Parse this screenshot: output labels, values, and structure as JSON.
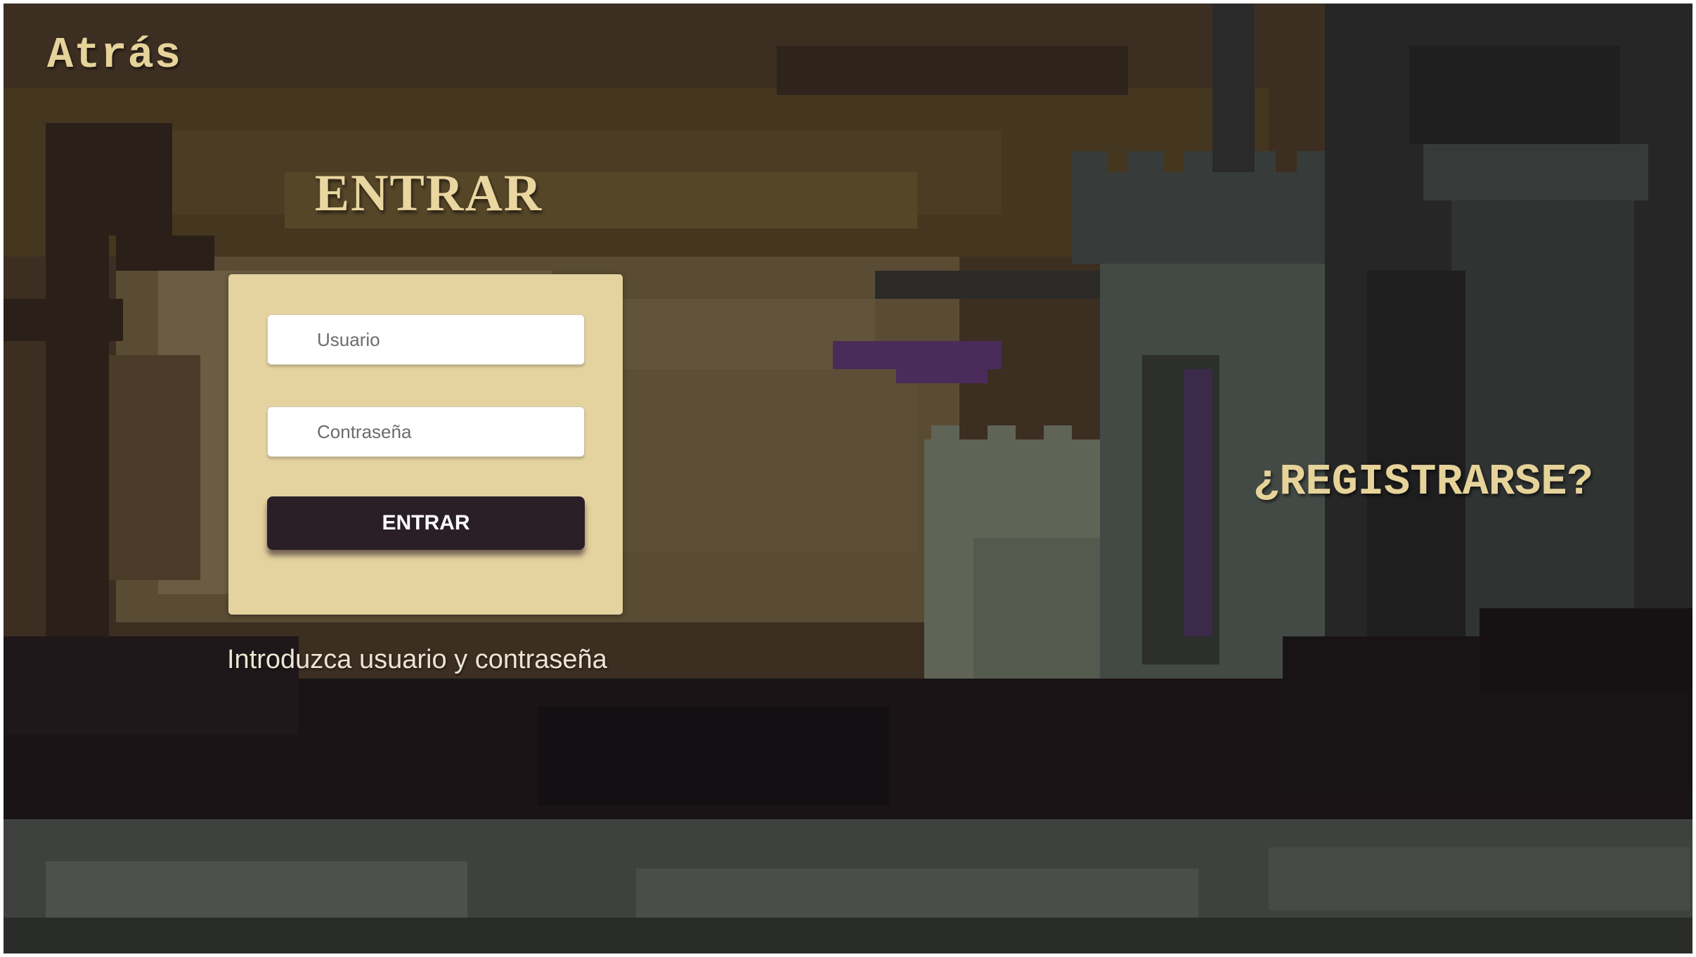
{
  "nav": {
    "back_label": "Atrás"
  },
  "login": {
    "title": "ENTRAR",
    "username_placeholder": "Usuario",
    "password_placeholder": "Contraseña",
    "submit_label": "ENTRAR",
    "hint": "Introduzca usuario y contraseña"
  },
  "register": {
    "label": "¿REGISTRARSE?"
  },
  "colors": {
    "accent_text": "#e6d39a",
    "card_bg": "#e4d39f",
    "button_bg": "#2b1f27",
    "button_text": "#ffffff"
  },
  "background": {
    "description_icon": "pixel-castle-landscape"
  }
}
